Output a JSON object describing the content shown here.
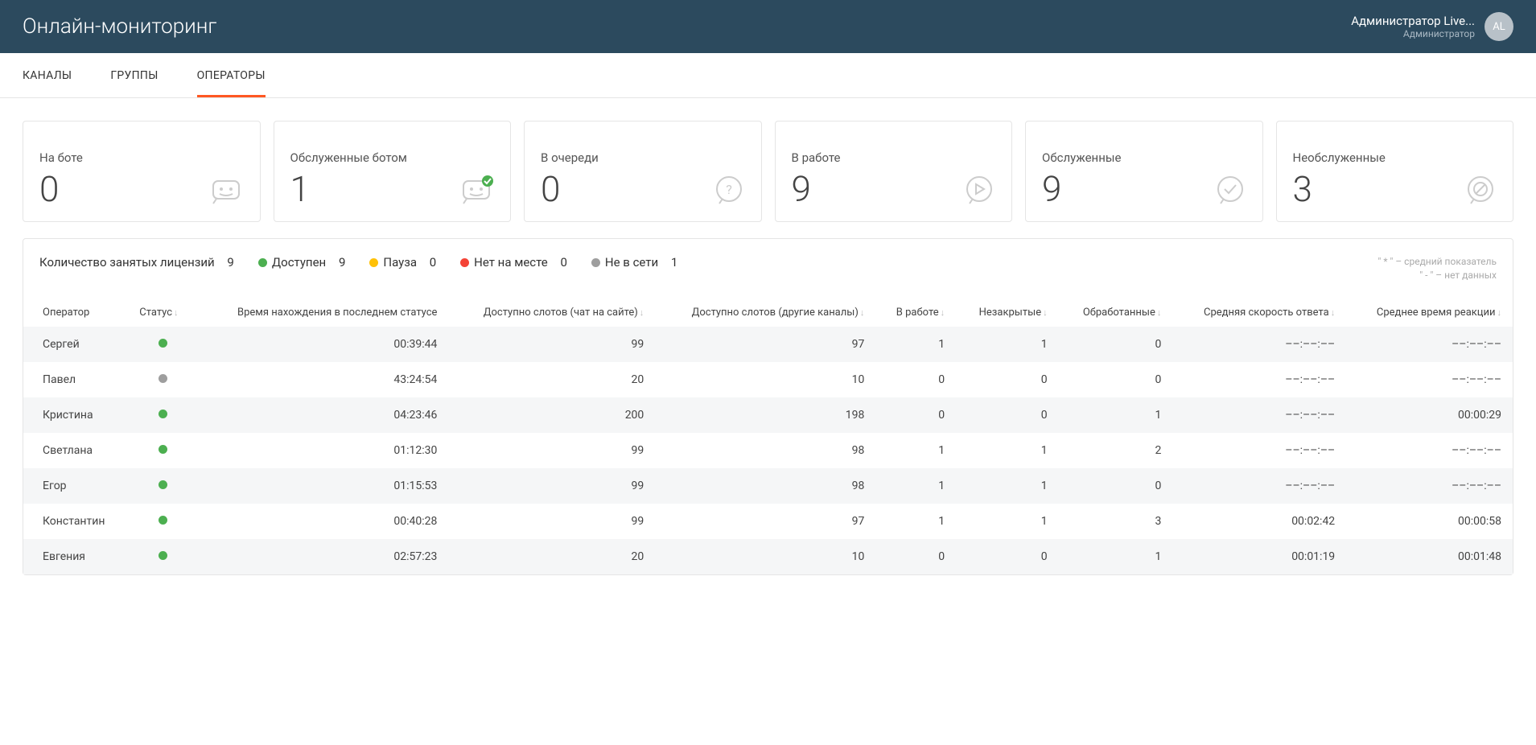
{
  "header": {
    "title": "Онлайн-мониторинг",
    "user_name": "Администратор Live...",
    "user_role": "Администратор",
    "avatar_initials": "AL"
  },
  "tabs": [
    {
      "label": "КАНАЛЫ",
      "active": false
    },
    {
      "label": "ГРУППЫ",
      "active": false
    },
    {
      "label": "ОПЕРАТОРЫ",
      "active": true
    }
  ],
  "cards": [
    {
      "label": "На боте",
      "value": "0",
      "icon": "bot"
    },
    {
      "label": "Обслуженные ботом",
      "value": "1",
      "icon": "bot-check"
    },
    {
      "label": "В очереди",
      "value": "0",
      "icon": "question"
    },
    {
      "label": "В работе",
      "value": "9",
      "icon": "play"
    },
    {
      "label": "Обслуженные",
      "value": "9",
      "icon": "check"
    },
    {
      "label": "Необслуженные",
      "value": "3",
      "icon": "block"
    }
  ],
  "licenses": {
    "title": "Количество занятых лицензий",
    "total": "9",
    "statuses": [
      {
        "label": "Доступен",
        "count": "9",
        "color": "green"
      },
      {
        "label": "Пауза",
        "count": "0",
        "color": "yellow"
      },
      {
        "label": "Нет на месте",
        "count": "0",
        "color": "red"
      },
      {
        "label": "Не в сети",
        "count": "1",
        "color": "grey"
      }
    ]
  },
  "legend": {
    "line1": "\" * \" – средний показатель",
    "line2": "\" - \" – нет данных"
  },
  "table": {
    "headers": [
      "Оператор",
      "Статус",
      "Время нахождения в последнем статусе",
      "Доступно слотов (чат на сайте)",
      "Доступно слотов (другие каналы)",
      "В работе",
      "Незакрытые",
      "Обработанные",
      "Средняя скорость ответа",
      "Среднее время реакции"
    ],
    "rows": [
      {
        "name": "Сергей",
        "status": "green",
        "time": "00:39:44",
        "slots_chat": "99",
        "slots_other": "97",
        "in_work": "1",
        "open": "1",
        "processed": "0",
        "avg_speed": "––:––:––",
        "avg_reaction": "––:––:––"
      },
      {
        "name": "Павел",
        "status": "grey",
        "time": "43:24:54",
        "slots_chat": "20",
        "slots_other": "10",
        "in_work": "0",
        "open": "0",
        "processed": "0",
        "avg_speed": "––:––:––",
        "avg_reaction": "––:––:––"
      },
      {
        "name": "Кристина",
        "status": "green",
        "time": "04:23:46",
        "slots_chat": "200",
        "slots_other": "198",
        "in_work": "0",
        "open": "0",
        "processed": "1",
        "avg_speed": "––:––:––",
        "avg_reaction": "00:00:29"
      },
      {
        "name": "Светлана",
        "status": "green",
        "time": "01:12:30",
        "slots_chat": "99",
        "slots_other": "98",
        "in_work": "1",
        "open": "1",
        "processed": "2",
        "avg_speed": "––:––:––",
        "avg_reaction": "––:––:––"
      },
      {
        "name": "Егор",
        "status": "green",
        "time": "01:15:53",
        "slots_chat": "99",
        "slots_other": "98",
        "in_work": "1",
        "open": "1",
        "processed": "0",
        "avg_speed": "––:––:––",
        "avg_reaction": "––:––:––"
      },
      {
        "name": "Константин",
        "status": "green",
        "time": "00:40:28",
        "slots_chat": "99",
        "slots_other": "97",
        "in_work": "1",
        "open": "1",
        "processed": "3",
        "avg_speed": "00:02:42",
        "avg_reaction": "00:00:58"
      },
      {
        "name": "Евгения",
        "status": "green",
        "time": "02:57:23",
        "slots_chat": "20",
        "slots_other": "10",
        "in_work": "0",
        "open": "0",
        "processed": "1",
        "avg_speed": "00:01:19",
        "avg_reaction": "00:01:48"
      }
    ]
  }
}
